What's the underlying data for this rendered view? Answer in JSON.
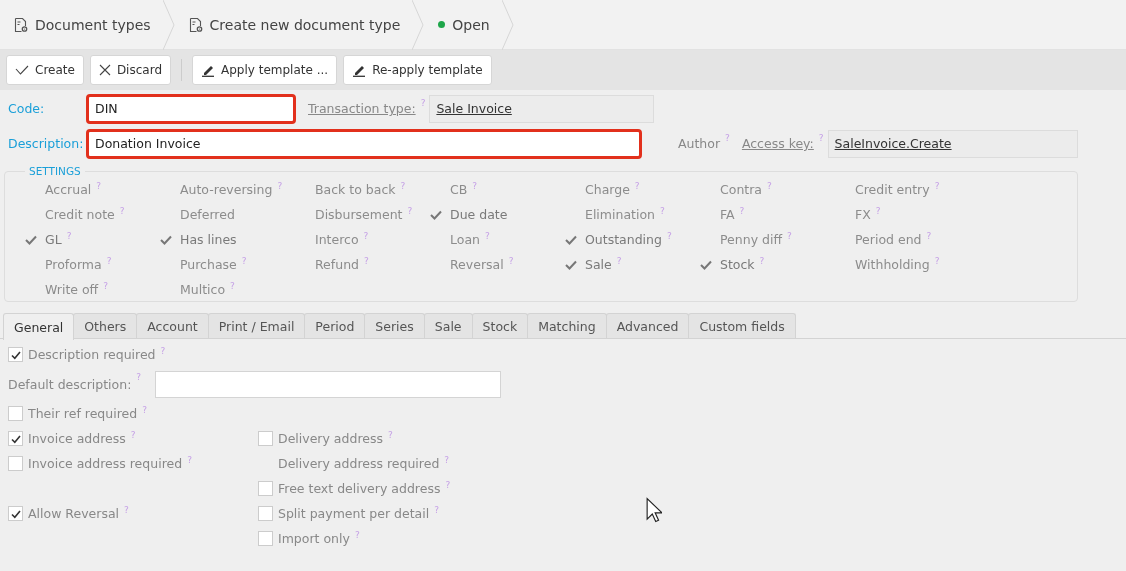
{
  "breadcrumbs": [
    {
      "label": "Document types",
      "kind": "doc"
    },
    {
      "label": "Create new document type",
      "kind": "doc"
    },
    {
      "label": "Open",
      "kind": "status",
      "color": "#1ea64a"
    }
  ],
  "toolbar": [
    {
      "label": "Create",
      "kind": "check"
    },
    {
      "label": "Discard",
      "kind": "cross"
    },
    {
      "label": "Apply template ...",
      "kind": "pen"
    },
    {
      "label": "Re-apply template",
      "kind": "pen"
    }
  ],
  "code": {
    "label": "Code:",
    "value": "DIN",
    "highlighted": true
  },
  "transaction_type": {
    "label": "Transaction type:",
    "hint": "?",
    "value": "Sale Invoice"
  },
  "description": {
    "label": "Description:",
    "value": "Donation Invoice",
    "highlighted": true
  },
  "author": {
    "label": "Author",
    "hint": "?"
  },
  "access_key": {
    "label": "Access key:",
    "hint": "?",
    "value": "SaleInvoice.Create"
  },
  "settings": {
    "title": "SETTINGS",
    "items": [
      {
        "label": "Accrual",
        "checked": false,
        "hint": "?"
      },
      {
        "label": "Auto-reversing",
        "checked": false,
        "hint": "?"
      },
      {
        "label": "Back to back",
        "checked": false,
        "hint": "?"
      },
      {
        "label": "CB",
        "checked": false,
        "hint": "?"
      },
      {
        "label": "Charge",
        "checked": false,
        "hint": "?"
      },
      {
        "label": "Contra",
        "checked": false,
        "hint": "?"
      },
      {
        "label": "Credit entry",
        "checked": false,
        "hint": "?"
      },
      {
        "label": "Credit note",
        "checked": false,
        "hint": "?"
      },
      {
        "label": "Deferred",
        "checked": false
      },
      {
        "label": "Disbursement",
        "checked": false,
        "hint": "?"
      },
      {
        "label": "Due date",
        "checked": true
      },
      {
        "label": "Elimination",
        "checked": false,
        "hint": "?"
      },
      {
        "label": "FA",
        "checked": false,
        "hint": "?"
      },
      {
        "label": "FX",
        "checked": false,
        "hint": "?"
      },
      {
        "label": "GL",
        "checked": true,
        "hint": "?"
      },
      {
        "label": "Has lines",
        "checked": true
      },
      {
        "label": "Interco",
        "checked": false,
        "hint": "?"
      },
      {
        "label": "Loan",
        "checked": false,
        "hint": "?"
      },
      {
        "label": "Outstanding",
        "checked": true,
        "hint": "?"
      },
      {
        "label": "Penny diff",
        "checked": false,
        "hint": "?"
      },
      {
        "label": "Period end",
        "checked": false,
        "hint": "?"
      },
      {
        "label": "Proforma",
        "checked": false,
        "hint": "?"
      },
      {
        "label": "Purchase",
        "checked": false,
        "hint": "?"
      },
      {
        "label": "Refund",
        "checked": false,
        "hint": "?"
      },
      {
        "label": "Reversal",
        "checked": false,
        "hint": "?"
      },
      {
        "label": "Sale",
        "checked": true,
        "hint": "?"
      },
      {
        "label": "Stock",
        "checked": true,
        "hint": "?"
      },
      {
        "label": "Withholding",
        "checked": false,
        "hint": "?"
      },
      {
        "label": "Write off",
        "checked": false,
        "hint": "?"
      },
      {
        "label": "Multico",
        "checked": false,
        "hint": "?"
      }
    ]
  },
  "tabs": [
    {
      "label": "General",
      "selected": true
    },
    {
      "label": "Others",
      "selected": false
    },
    {
      "label": "Account",
      "selected": false
    },
    {
      "label": "Print / Email",
      "selected": false
    },
    {
      "label": "Period",
      "selected": false
    },
    {
      "label": "Series",
      "selected": false
    },
    {
      "label": "Sale",
      "selected": false
    },
    {
      "label": "Stock",
      "selected": false
    },
    {
      "label": "Matching",
      "selected": false
    },
    {
      "label": "Advanced",
      "selected": false
    },
    {
      "label": "Custom fields",
      "selected": false
    }
  ],
  "general": {
    "description_required": {
      "label": "Description required",
      "checked": true,
      "hint": "?"
    },
    "default_description": {
      "label": "Default description:",
      "hint": "?"
    },
    "rows": [
      {
        "left": {
          "kind": "checkbox",
          "label": "Their ref required",
          "checked": false,
          "hint": "?"
        }
      },
      {
        "left": {
          "kind": "checkbox",
          "label": "Invoice address",
          "checked": true,
          "hint": "?"
        },
        "right": {
          "kind": "checkbox",
          "label": "Delivery address",
          "checked": false,
          "hint": "?"
        }
      },
      {
        "left": {
          "kind": "checkbox",
          "label": "Invoice address required",
          "checked": false,
          "hint": "?"
        },
        "right": {
          "kind": "label",
          "label": "Delivery address required",
          "hint": "?"
        }
      },
      {
        "right": {
          "kind": "checkbox",
          "label": "Free text delivery address",
          "checked": false,
          "hint": "?"
        }
      },
      {
        "left": {
          "kind": "checkbox",
          "label": "Allow Reversal",
          "checked": true,
          "hint": "?"
        },
        "right": {
          "kind": "checkbox",
          "label": "Split payment per detail",
          "checked": false,
          "hint": "?"
        }
      },
      {
        "right": {
          "kind": "checkbox",
          "label": "Import only",
          "checked": false,
          "hint": "?"
        }
      }
    ]
  }
}
